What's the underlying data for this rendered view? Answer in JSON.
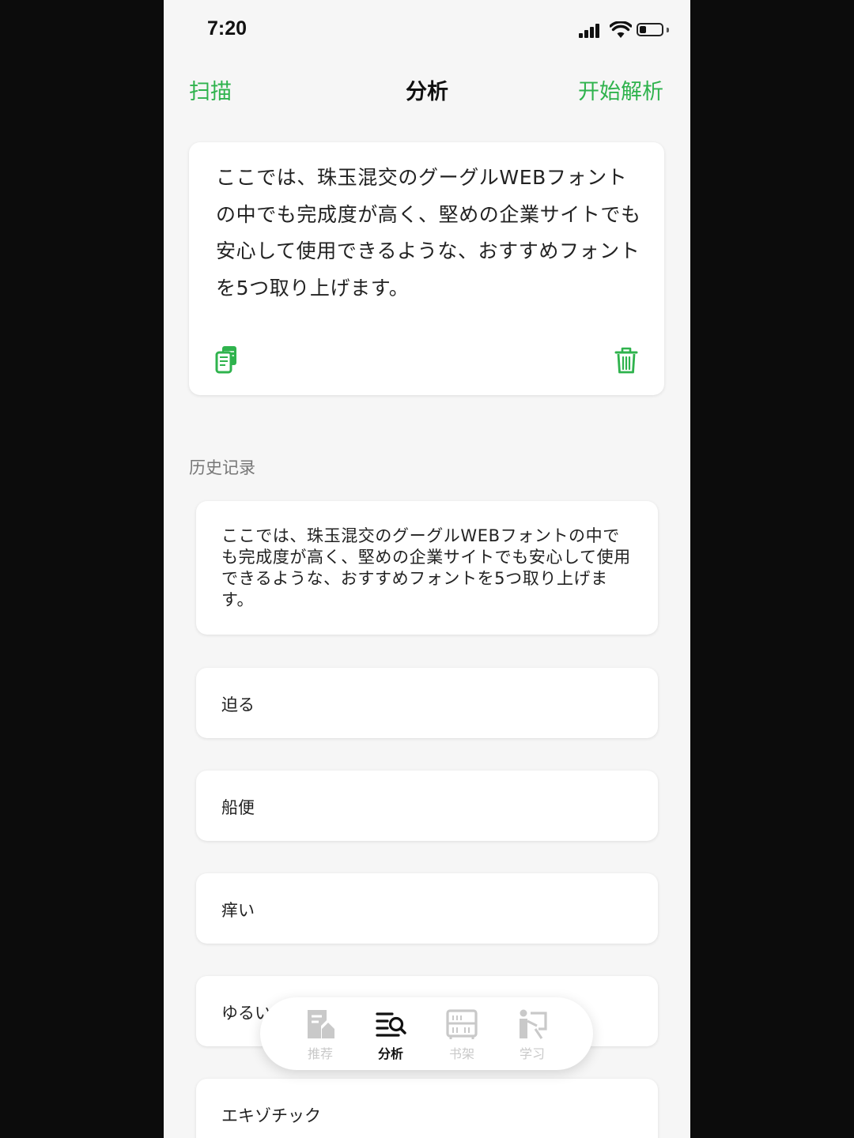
{
  "status_bar": {
    "time": "7:20"
  },
  "nav": {
    "left": "扫描",
    "title": "分析",
    "right": "开始解析"
  },
  "input_card": {
    "text": "ここでは、珠玉混交のグーグルWEBフォントの中でも完成度が高く、堅めの企業サイトでも安心して使用できるような、おすすめフォントを5つ取り上げます。",
    "copy_icon": "copy-icon",
    "delete_icon": "trash-icon"
  },
  "history": {
    "label": "历史记录",
    "items": [
      "ここでは、珠玉混交のグーグルWEBフォントの中でも完成度が高く、堅めの企業サイトでも安心して使用できるような、おすすめフォントを5つ取り上げます。",
      "迫る",
      "船便",
      "痒い",
      "ゆるい",
      "エキゾチック"
    ]
  },
  "tab_bar": {
    "tabs": [
      {
        "label": "推荐",
        "icon": "recommend-icon"
      },
      {
        "label": "分析",
        "icon": "analysis-icon",
        "active": true
      },
      {
        "label": "书架",
        "icon": "bookshelf-icon"
      },
      {
        "label": "学习",
        "icon": "study-icon"
      }
    ]
  },
  "colors": {
    "accent": "#2fb34d",
    "background": "#f6f6f6",
    "card": "#ffffff",
    "inactive_tab": "#c9c9c9"
  }
}
